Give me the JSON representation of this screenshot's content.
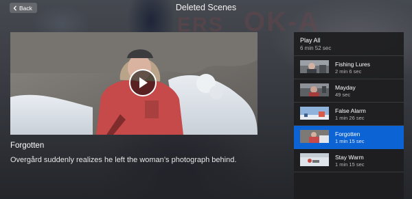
{
  "header": {
    "back_label": "Back",
    "title": "Deleted Scenes"
  },
  "backdrop": {
    "text_1": "ERS",
    "text_2": "OK-A"
  },
  "player": {
    "state": "paused",
    "play_icon": "play-icon"
  },
  "scene": {
    "title": "Forgotten",
    "description": "Overgård suddenly realizes he left the woman’s photograph behind."
  },
  "playlist": {
    "play_all_label": "Play All",
    "play_all_duration": "6 min 52 sec",
    "items": [
      {
        "title": "Fishing Lures",
        "duration": "2 min 6 sec",
        "active": false
      },
      {
        "title": "Mayday",
        "duration": "49 sec",
        "active": false
      },
      {
        "title": "False Alarm",
        "duration": "1 min 26 sec",
        "active": false
      },
      {
        "title": "Forgotten",
        "duration": "1 min 15 sec",
        "active": true
      },
      {
        "title": "Stay Warm",
        "duration": "1 min 15 sec",
        "active": false
      }
    ]
  },
  "colors": {
    "accent": "#0b63d4",
    "panel_bg": "#1e1e20",
    "text_secondary": "#b8b8b8"
  }
}
